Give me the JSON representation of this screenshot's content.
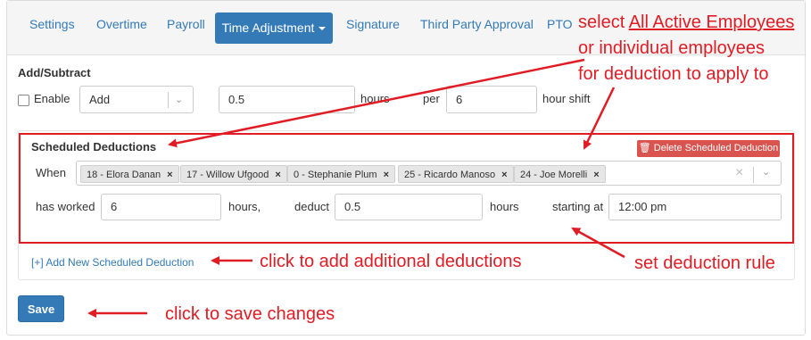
{
  "tabs": [
    {
      "label": "Settings"
    },
    {
      "label": "Overtime"
    },
    {
      "label": "Payroll"
    },
    {
      "label": "Time Adjustment",
      "active": true
    },
    {
      "label": "Signature"
    },
    {
      "label": "Third Party Approval"
    },
    {
      "label": "PTO"
    }
  ],
  "add_subtract": {
    "section_title": "Add/Subtract",
    "enable_label": "Enable",
    "enabled": false,
    "mode_value": "Add",
    "amount_value": "0.5",
    "hours_label": "hours",
    "per_label": "per",
    "shift_value": "6",
    "shift_label": "hour shift"
  },
  "scheduled": {
    "title": "Scheduled Deductions",
    "delete_label": "Delete Scheduled Deduction",
    "when_label": "When",
    "employees": [
      {
        "label": "18 - Elora Danan"
      },
      {
        "label": "17 - Willow Ufgood"
      },
      {
        "label": "0 - Stephanie Plum"
      },
      {
        "label": "25 - Ricardo Manoso"
      },
      {
        "label": "24 - Joe Morelli"
      }
    ],
    "clear_glyph": "×",
    "has_worked_label": "has worked",
    "worked_value": "6",
    "hours_comma_label": "hours,",
    "deduct_label": "deduct",
    "deduct_value": "0.5",
    "hours_label": "hours",
    "starting_label": "starting at",
    "start_value": "12:00 pm"
  },
  "add_new_label": "[+] Add New Scheduled Deduction",
  "save_label": "Save",
  "annotations": {
    "select_prefix": "select ",
    "select_link": "All Active Employees",
    "select_line2": "or individual employees",
    "select_line3": "for deduction to apply to",
    "add_deductions": "click to add additional deductions",
    "rule": "set deduction rule",
    "save": "click to save changes"
  },
  "colors": {
    "accent": "#337ab7",
    "annotation_red": "#e01c24",
    "danger": "#d9534f"
  }
}
